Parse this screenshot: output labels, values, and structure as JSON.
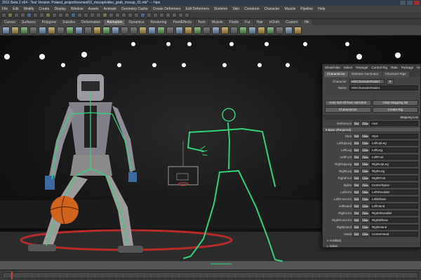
{
  "window": {
    "title": "Autodesk Maya 2011 Beta 2 x64 - Test Version: Poland_project/scenes/03_mocap/video_grab_mocap_01.mb* --- hips",
    "title_short": "2011 Beta 2 x64 - Test Version: Poland_project/scenes/03_mocap/video_grab_mocap_01.mb* --- hips"
  },
  "menubar": [
    "File",
    "Edit",
    "Modify",
    "Create",
    "Display",
    "Window",
    "Assets",
    "Animate",
    "Geometry Cache",
    "Create Deformers",
    "Edit Deformers",
    "Skeleton",
    "Skin",
    "Constrain",
    "Character",
    "Muscle",
    "Pipeline",
    "Help"
  ],
  "shelf_tabs": {
    "items": [
      "Curves",
      "Surfaces",
      "Polygons",
      "Subdivs",
      "Deformation",
      "Animation",
      "Dynamics",
      "Rendering",
      "PaintEffects",
      "Toon",
      "Muscle",
      "Fluids",
      "Fur",
      "Hair",
      "nCloth",
      "Custom",
      "Hik"
    ],
    "active": "Animation"
  },
  "hik_panel": {
    "menu": [
      "Show/Hide",
      "Select",
      "Retarget",
      "Control Rig",
      "Rate",
      "Package",
      "Help"
    ],
    "tabs": [
      "Characterize",
      "Skeleton Generator",
      "Character Rigs"
    ],
    "active_tab": "Characterize",
    "character_label": "Character:",
    "character_value": "HIKCharacterNode1",
    "character_button": "▾",
    "name_label": "Name:",
    "name_value": "HIKCharacterNode1",
    "buttons_row1": [
      "Auto Get All from selection",
      "Clear Mapping list"
    ],
    "buttons_row2": [
      "Characterize",
      "Create Rig"
    ],
    "mapping_header": "Mapping List",
    "reference_label": "Reference",
    "reference_value": "root",
    "section_base": "Base (Required)",
    "set_label": "Set",
    "clear_label": "Clear",
    "joints": [
      {
        "label": "Hips",
        "value": "Hips"
      },
      {
        "label": "LeftUpLeg",
        "value": "LeftUpLeg"
      },
      {
        "label": "LeftLeg",
        "value": "LeftLeg"
      },
      {
        "label": "LeftFoot",
        "value": "LeftFoot"
      },
      {
        "label": "RightUpLeg",
        "value": "RightUpLeg"
      },
      {
        "label": "RightLeg",
        "value": "RightLeg"
      },
      {
        "label": "RightFoot",
        "value": "RightFoot"
      },
      {
        "label": "Spine",
        "value": "CenterSpine"
      },
      {
        "label": "LeftArm",
        "value": "LeftShoulder"
      },
      {
        "label": "LeftForeArm",
        "value": "LeftElbow"
      },
      {
        "label": "LeftHand",
        "value": "LeftHand"
      },
      {
        "label": "RightArm",
        "value": "RightShoulder"
      },
      {
        "label": "RightForeArm",
        "value": "RightElbow"
      },
      {
        "label": "RightHand",
        "value": "RightHand"
      },
      {
        "label": "Head",
        "value": "CenterHead"
      }
    ],
    "subsections": [
      "Auxiliary",
      "Spine",
      "Neck"
    ]
  },
  "colors": {
    "accent_green": "#34d17a",
    "panel_bg": "#444444",
    "viewport_bg": "#111111",
    "floor_red": "#b52a2a"
  }
}
